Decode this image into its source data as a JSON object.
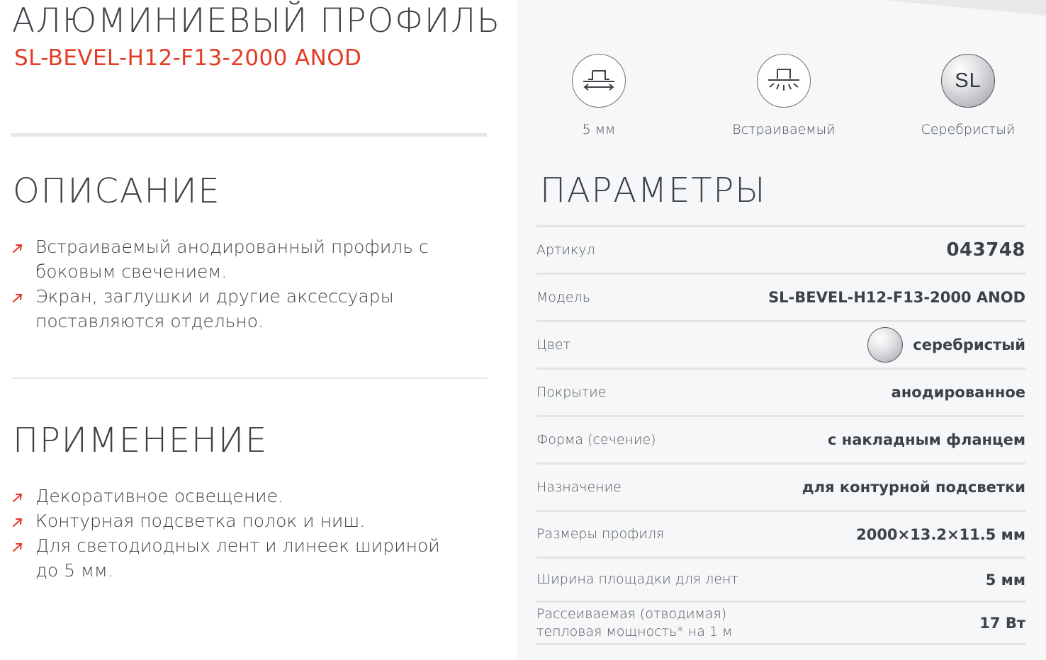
{
  "header": {
    "title": "АЛЮМИНИЕВЫЙ ПРОФИЛЬ",
    "model": "SL-BEVEL-H12-F13-2000 ANOD"
  },
  "description": {
    "heading": "ОПИСАНИЕ",
    "items": [
      "Встраиваемый анодированный профиль с боковым свечением.",
      "Экран, заглушки и другие аксессуары поставляются отдельно."
    ]
  },
  "application": {
    "heading": "ПРИМЕНЕНИЕ",
    "items": [
      "Декоративное освещение.",
      "Контурная подсветка полок и ниш.",
      "Для светодиодных лент и линеек шириной до 5 мм."
    ]
  },
  "features": [
    {
      "label": "5 мм",
      "icon": "width-profile-icon"
    },
    {
      "label": "Встраиваемый",
      "icon": "recessed-profile-icon"
    },
    {
      "label": "Серебристый",
      "icon": "silver-color-icon",
      "badge": "SL"
    }
  ],
  "params": {
    "heading": "ПАРАМЕТРЫ",
    "rows": [
      {
        "label": "Артикул",
        "value": "043748"
      },
      {
        "label": "Модель",
        "value": "SL-BEVEL-H12-F13-2000 ANOD"
      },
      {
        "label": "Цвет",
        "value": "серебристый"
      },
      {
        "label": "Покрытие",
        "value": "анодированное"
      },
      {
        "label": "Форма (сечение)",
        "value": "с накладным фланцем"
      },
      {
        "label": "Назначение",
        "value": "для контурной подсветки"
      },
      {
        "label": "Размеры профиля",
        "value": "2000×13.2×11.5 мм"
      },
      {
        "label": "Ширина площадки для лент",
        "value": "5 мм"
      },
      {
        "label": "Рассеиваемая (отводимая) тепловая мощность* на 1 м",
        "value": "17 Вт"
      }
    ]
  },
  "colors": {
    "accent": "#e33b26",
    "text": "#3d4248",
    "panel": "#f6f7f8",
    "divider": "#e3e4e6"
  }
}
